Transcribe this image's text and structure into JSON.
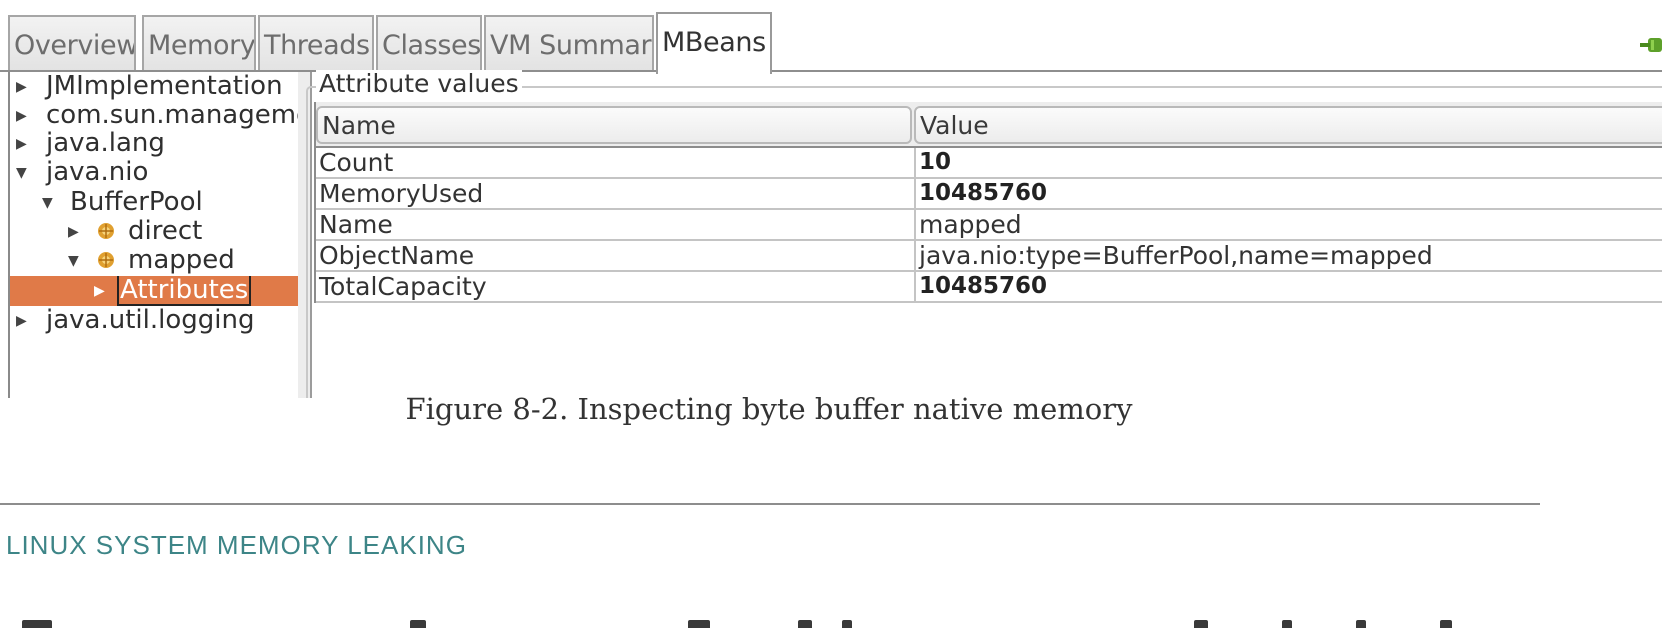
{
  "tabs": [
    "Overview",
    "Memory",
    "Threads",
    "Classes",
    "VM Summary",
    "MBeans"
  ],
  "active_tab": "MBeans",
  "tree": {
    "items": [
      {
        "label": "JMImplementation",
        "expanded": false
      },
      {
        "label": "com.sun.manageme",
        "expanded": false
      },
      {
        "label": "java.lang",
        "expanded": false
      },
      {
        "label": "java.nio",
        "expanded": true
      },
      {
        "label": "BufferPool",
        "expanded": true
      },
      {
        "label": "direct",
        "expanded": false,
        "icon": "mbean-icon"
      },
      {
        "label": "mapped",
        "expanded": true,
        "icon": "mbean-icon"
      },
      {
        "label": "Attributes",
        "expanded": false,
        "selected": true
      },
      {
        "label": "java.util.logging",
        "expanded": false
      }
    ]
  },
  "attributes": {
    "title": "Attribute values",
    "columns": [
      "Name",
      "Value"
    ],
    "rows": [
      {
        "name": "Count",
        "value": "10",
        "bold": true
      },
      {
        "name": "MemoryUsed",
        "value": "10485760",
        "bold": true
      },
      {
        "name": "Name",
        "value": "mapped",
        "bold": false
      },
      {
        "name": "ObjectName",
        "value": "java.nio:type=BufferPool,name=mapped",
        "bold": false
      },
      {
        "name": "TotalCapacity",
        "value": "10485760",
        "bold": true
      }
    ]
  },
  "caption": "Figure 8-2. Inspecting byte buffer native memory",
  "section_heading": "LINUX SYSTEM MEMORY LEAKING",
  "colors": {
    "selection": "#e07a48",
    "heading": "#3d8587"
  }
}
